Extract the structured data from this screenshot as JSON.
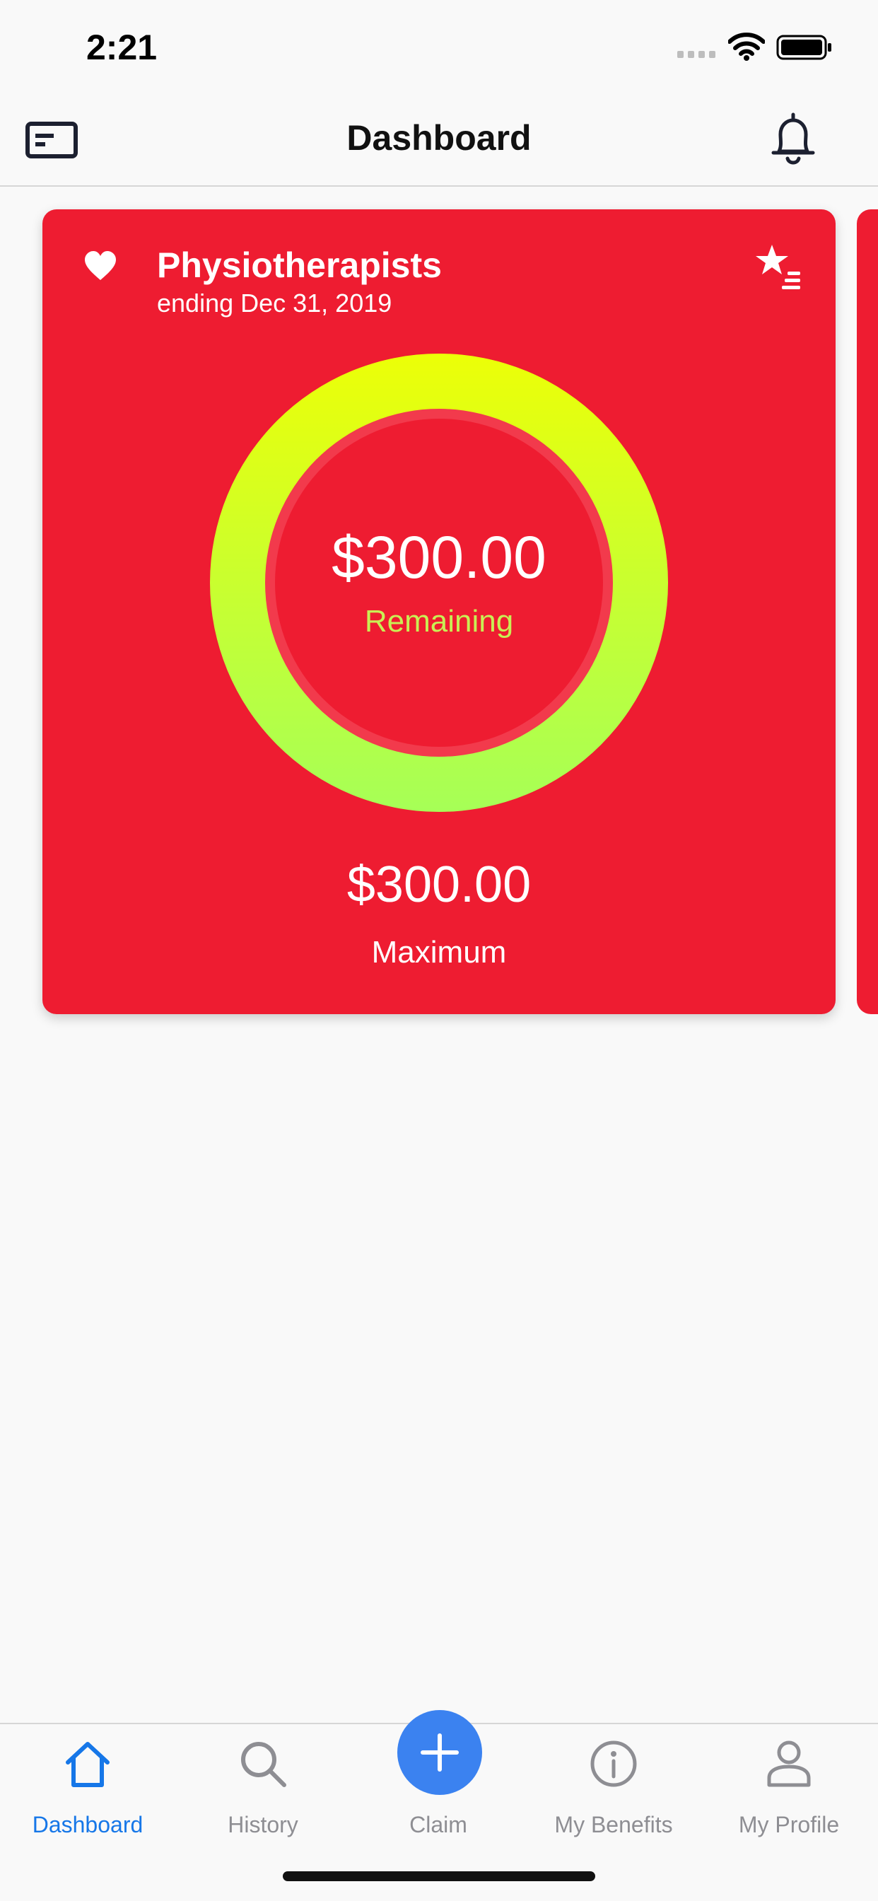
{
  "status_bar": {
    "time": "2:21"
  },
  "nav": {
    "title": "Dashboard",
    "left_icon": "card-icon",
    "right_icon": "bell-icon"
  },
  "benefit_card": {
    "title": "Physiotherapists",
    "subtitle": "ending Dec 31, 2019",
    "remaining_amount": "$300.00",
    "remaining_label": "Remaining",
    "remaining_fraction": 1.0,
    "maximum_amount": "$300.00",
    "maximum_label": "Maximum",
    "left_icon": "heart-icon",
    "right_icon": "favorites-list-icon"
  },
  "colors": {
    "card_background": "#ee1c31",
    "ring_gradient_top": "#ecff07",
    "ring_gradient_bottom": "#a6ff57",
    "accent": "#1677e8",
    "claim_button": "#3b82f0"
  },
  "tabs": [
    {
      "label": "Dashboard",
      "icon": "home-icon",
      "active": true
    },
    {
      "label": "History",
      "icon": "search-icon",
      "active": false
    },
    {
      "label": "Claim",
      "icon": "plus-icon",
      "active": false
    },
    {
      "label": "My Benefits",
      "icon": "info-icon",
      "active": false
    },
    {
      "label": "My Profile",
      "icon": "person-icon",
      "active": false
    }
  ]
}
